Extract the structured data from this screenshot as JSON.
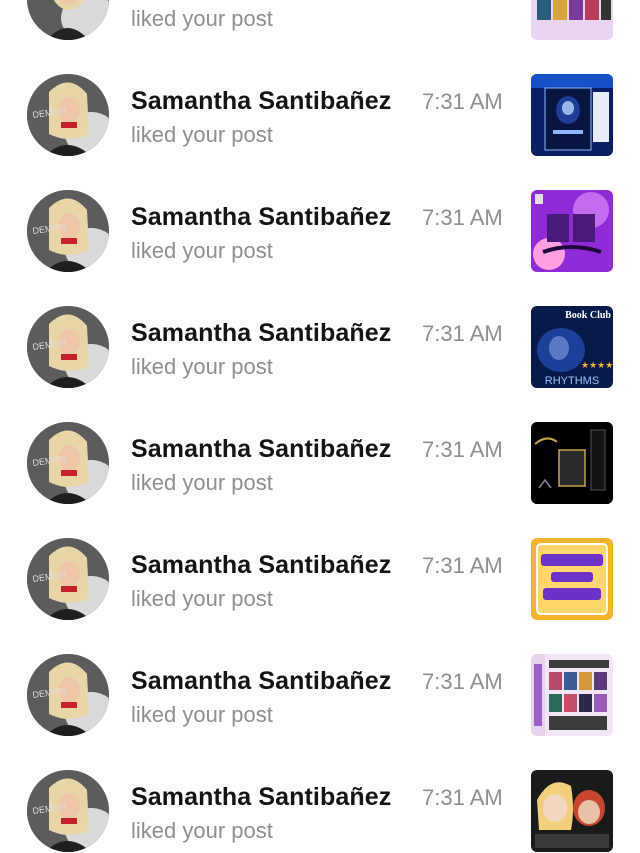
{
  "notifications": [
    {
      "action": "liked your post",
      "thumb_icon": "book-collage-thumbnail",
      "thumb_colors": [
        "#e9d3f2",
        "#c24fd8",
        "#3b3b5a"
      ]
    },
    {
      "name": "Samantha Santibañez",
      "time": "7:31 AM",
      "action": "liked your post",
      "thumb_icon": "midnight-blues-book-thumbnail",
      "thumb_colors": [
        "#0a1f63",
        "#1650c7",
        "#8fb6ff"
      ]
    },
    {
      "name": "Samantha Santibañez",
      "time": "7:31 AM",
      "action": "liked your post",
      "thumb_icon": "my-fav-bookapps-thumbnail",
      "thumb_colors": [
        "#8f2bd6",
        "#c46cf0",
        "#ff9ee0"
      ]
    },
    {
      "name": "Samantha Santibañez",
      "time": "7:31 AM",
      "action": "liked your post",
      "thumb_text": "Book Club",
      "thumb_subtext": "RHYTHMS",
      "thumb_icon": "book-club-thumbnail",
      "thumb_colors": [
        "#061a4a",
        "#1c3f99",
        "#f2b636"
      ]
    },
    {
      "name": "Samantha Santibañez",
      "time": "7:31 AM",
      "action": "liked your post",
      "thumb_icon": "currently-reading-thumbnail",
      "thumb_colors": [
        "#000000",
        "#2a2a2a",
        "#c9a24d"
      ]
    },
    {
      "name": "Samantha Santibañez",
      "time": "7:31 AM",
      "action": "liked your post",
      "thumb_icon": "new-book-rating-thumbnail",
      "thumb_colors": [
        "#f3b42a",
        "#ffd66a",
        "#6a32c9"
      ]
    },
    {
      "name": "Samantha Santibañez",
      "time": "7:31 AM",
      "action": "liked your post",
      "thumb_icon": "books-to-read-thumbnail",
      "thumb_colors": [
        "#f0e6f4",
        "#7a2fb8",
        "#3c3c3c"
      ]
    },
    {
      "name": "Samantha Santibañez",
      "time": "7:31 AM",
      "action": "liked your post",
      "thumb_icon": "cartoon-characters-thumbnail",
      "thumb_colors": [
        "#1a1a1a",
        "#f2cf7a",
        "#c9472e"
      ]
    }
  ]
}
